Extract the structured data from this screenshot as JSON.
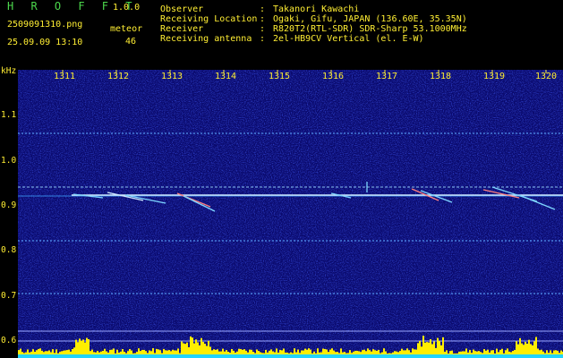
{
  "header": {
    "app_name": "H R O F F T",
    "version": "1.0.0",
    "file_name": "2509091310.png",
    "date_time": "25.09.09 13:10",
    "count_label": "meteor",
    "count_value": "46"
  },
  "station": [
    {
      "label": "Observer",
      "value": "Takanori Kawachi"
    },
    {
      "label": "Receiving Location",
      "value": "Ogaki, Gifu, JAPAN (136.60E, 35.35N)"
    },
    {
      "label": "Receiver",
      "value": "R820T2(RTL-SDR) SDR-Sharp 53.1000MHz"
    },
    {
      "label": "Receiving antenna",
      "value": "2el-HB9CV Vertical (el. E-W)"
    }
  ],
  "axis": {
    "y_unit": "kHz",
    "y_ticks": [
      "1.1",
      "1.0",
      "0.9",
      "0.8",
      "0.7",
      "0.6"
    ],
    "x_ticks": [
      "1311",
      "1312",
      "1313",
      "1314",
      "1315",
      "1316",
      "1317",
      "1318",
      "1319",
      "1320"
    ]
  },
  "colors": {
    "header_text": "#4cd84c",
    "axis_text": "#ffee33",
    "background": "#0a0a6e",
    "signal_line": "#7ed6ff",
    "meteor": "#cfe8ff",
    "level_bar": "#ffee00"
  }
}
